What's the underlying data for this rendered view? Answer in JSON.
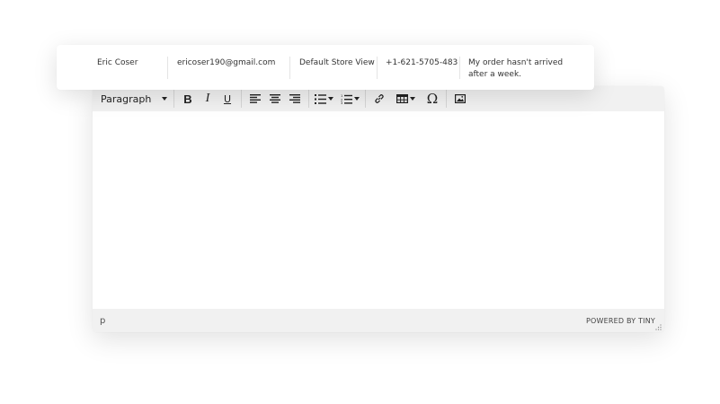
{
  "order_row": {
    "customer_name": "Eric Coser",
    "email": "ericoser190@gmail.com",
    "store_view": "Default Store View",
    "phone": "+1-621-5705-483",
    "message_line1": "My order hasn't arrived",
    "message_line2": "after a week."
  },
  "editor": {
    "toolbar": {
      "block_format": "Paragraph",
      "bold_label": "B",
      "italic_label": "I",
      "underline_label": "U",
      "special_char_label": "Ω"
    },
    "status": {
      "path": "p",
      "branding": "POWERED BY TINY"
    }
  },
  "icons": [
    "chevron-down-icon",
    "bold-icon",
    "italic-icon",
    "underline-icon",
    "align-left-icon",
    "align-center-icon",
    "align-right-icon",
    "bullet-list-icon",
    "numbered-list-icon",
    "link-icon",
    "table-icon",
    "special-character-icon",
    "image-icon",
    "resize-handle-icon"
  ]
}
